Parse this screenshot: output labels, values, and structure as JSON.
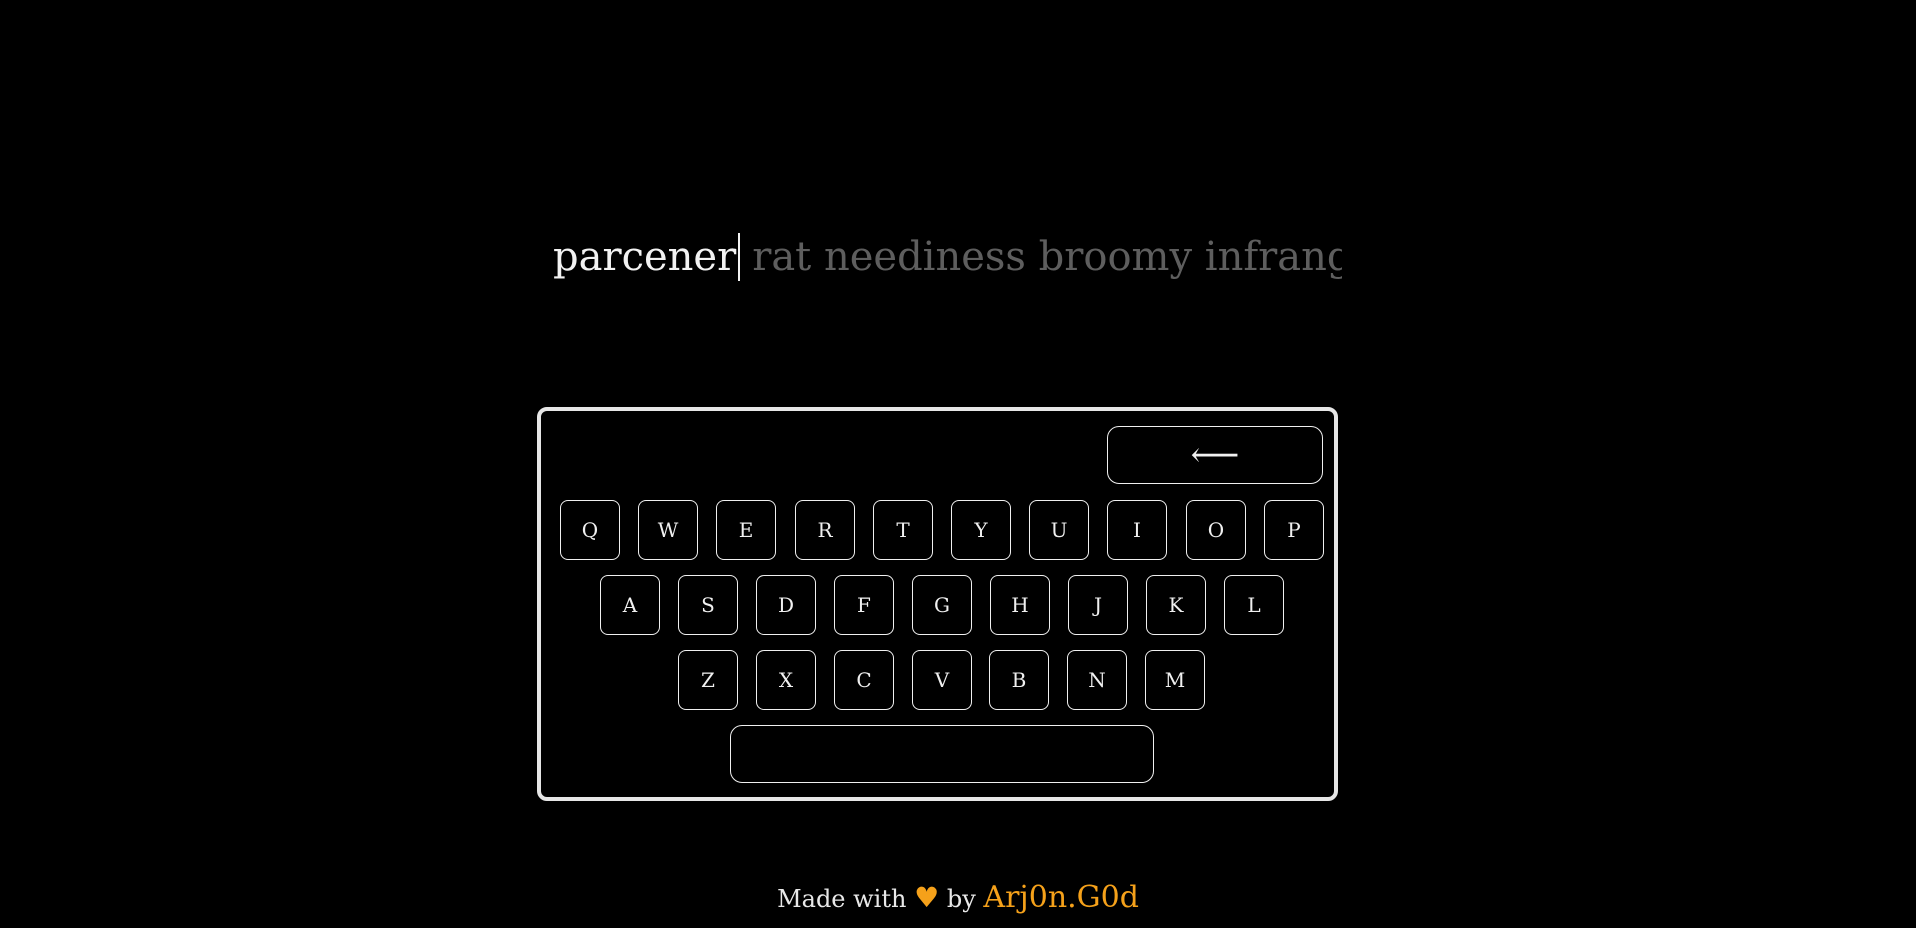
{
  "typing": {
    "typed_word": "parcener",
    "upcoming_text": "rat neediness broomy infrangible"
  },
  "keyboard": {
    "backspace_label": "⟵",
    "rows": [
      [
        "Q",
        "W",
        "E",
        "R",
        "T",
        "Y",
        "U",
        "I",
        "O",
        "P"
      ],
      [
        "A",
        "S",
        "D",
        "F",
        "G",
        "H",
        "J",
        "K",
        "L"
      ],
      [
        "Z",
        "X",
        "C",
        "V",
        "B",
        "N",
        "M"
      ]
    ]
  },
  "footer": {
    "made_with": "Made with",
    "heart": "♥",
    "by": "by",
    "author": "Arj0n.G0d"
  },
  "colors": {
    "background": "#000000",
    "typed_text": "#f2f2f2",
    "upcoming_text": "#5e5e5e",
    "accent": "#f5a11a"
  }
}
